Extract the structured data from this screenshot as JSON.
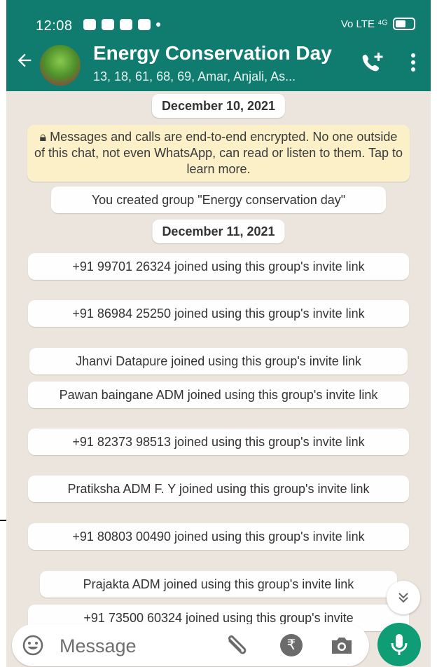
{
  "status_bar": {
    "time": "12:08",
    "right_text": "Vo LTE ⁴ᴳ"
  },
  "header": {
    "title": "Energy Conservation Day",
    "subtitle": "13, 18, 61, 68, 69, Amar, Anjali, As..."
  },
  "messages": [
    {
      "kind": "date",
      "text": "December 10, 2021"
    },
    {
      "kind": "encryption",
      "text": "Messages and calls are end-to-end encrypted. No one outside of this chat, not even WhatsApp, can read or listen to them. Tap to learn more."
    },
    {
      "kind": "system",
      "text": "You created group \"Energy conservation day\""
    },
    {
      "kind": "date",
      "text": "December 11, 2021"
    },
    {
      "kind": "system",
      "text": "+91 99701 26324 joined using this group's invite link"
    },
    {
      "kind": "system",
      "text": "+91 86984 25250 joined using this group's invite link"
    },
    {
      "kind": "system",
      "text": "Jhanvi Datapure joined using this group's invite link"
    },
    {
      "kind": "system",
      "text": "Pawan baingane ADM joined using this group's invite link"
    },
    {
      "kind": "system",
      "text": "+91 82373 98513 joined using this group's invite link"
    },
    {
      "kind": "system",
      "text": "Pratiksha ADM F. Y joined using this group's invite link"
    },
    {
      "kind": "system",
      "text": "+91 80803 00490 joined using this group's invite link"
    },
    {
      "kind": "system",
      "text": "Prajakta ADM joined using this group's invite link"
    },
    {
      "kind": "system",
      "text": "+91 73500 60324 joined using this group's invite"
    }
  ],
  "composer": {
    "placeholder": "Message"
  },
  "colors": {
    "header": "#0f7c6f",
    "chat_bg": "#ece5dd",
    "encryption_bg": "#fcf0c9",
    "mic": "#0f9d75"
  },
  "icons": [
    "back-arrow-icon",
    "add-call-icon",
    "more-vert-icon",
    "emoji-icon",
    "attach-icon",
    "rupee-icon",
    "camera-icon",
    "mic-icon",
    "scroll-down-icon"
  ]
}
